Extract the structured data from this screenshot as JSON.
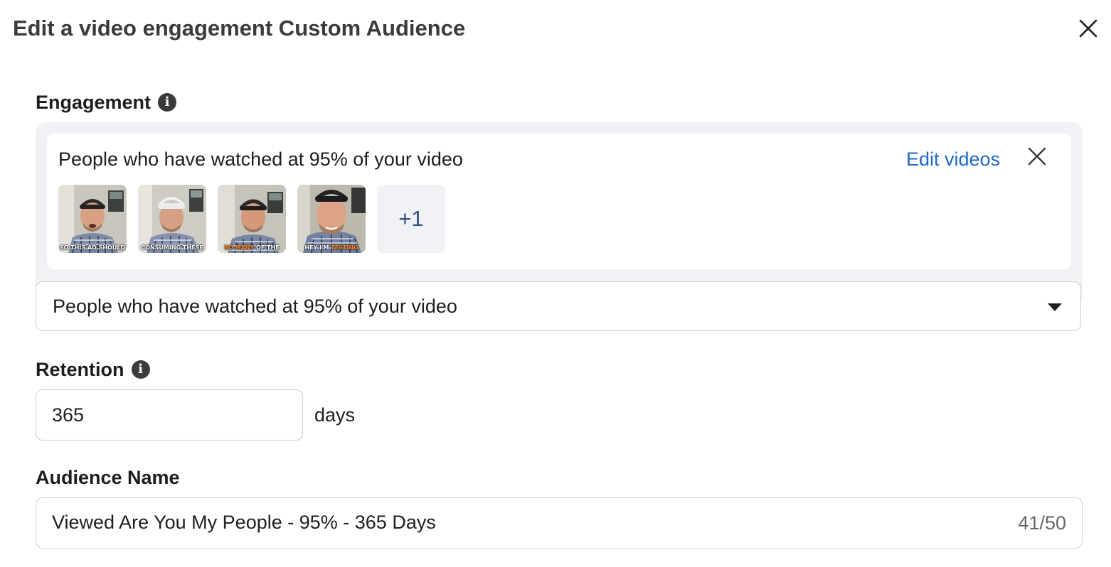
{
  "dialog": {
    "title": "Edit a video engagement Custom Audience"
  },
  "engagement": {
    "label": "Engagement",
    "card_title": "People who have watched at 95% of your video",
    "edit_videos_label": "Edit videos",
    "thumbnails": [
      {
        "caption_before": "SO THIS AD SHOULD",
        "caption_highlight": "",
        "caption_after": ""
      },
      {
        "caption_before": "CONSUMING THESE",
        "caption_highlight": "",
        "caption_after": ""
      },
      {
        "caption_before": "",
        "caption_highlight": "SO MANY",
        "caption_after": " OF THE"
      },
      {
        "caption_before": "HEY I'M ",
        "caption_highlight": "TESTING",
        "caption_after": ""
      }
    ],
    "more_count": "+1",
    "select_value": "People who have watched at 95% of your video"
  },
  "retention": {
    "label": "Retention",
    "value": "365",
    "unit": "days"
  },
  "audience_name": {
    "label": "Audience Name",
    "value": "Viewed Are You My People - 95% - 365 Days",
    "count": "41/50"
  },
  "icons": {
    "close": "close-icon",
    "info": "info-icon",
    "caret": "caret-down-icon"
  },
  "colors": {
    "link": "#1b6ac9",
    "panel_bg": "#f0f2f5",
    "border": "#ced0d4",
    "more_text": "#344e86",
    "caption_highlight": "#ff8a1f"
  }
}
